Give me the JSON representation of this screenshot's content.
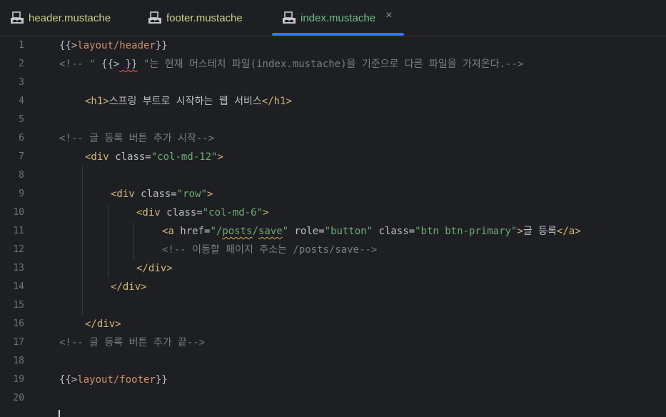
{
  "tabs": [
    {
      "label": "header.mustache",
      "icon": "mustache-file-icon",
      "active": false
    },
    {
      "label": "footer.mustache",
      "icon": "mustache-file-icon",
      "active": false
    },
    {
      "label": "index.mustache",
      "icon": "mustache-file-icon",
      "active": true,
      "close": "×"
    }
  ],
  "line_numbers": [
    "1",
    "2",
    "3",
    "4",
    "5",
    "6",
    "7",
    "8",
    "9",
    "10",
    "11",
    "12",
    "13",
    "14",
    "15",
    "16",
    "17",
    "18",
    "19",
    "20"
  ],
  "code": {
    "l1": {
      "open": "{{>",
      "path": "layout/header",
      "close": "}}"
    },
    "l2": {
      "a": "<!-- \" ",
      "b": "{{>",
      "c": " }}",
      "d": " \"는 현재 머스테치 파일(index.mustache)을 기준으로 다른 파일을 가져온다.-->"
    },
    "l4": {
      "open": "<h1>",
      "text": "스프링 부트로 시작하는 웹 서비스",
      "close": "</h1>"
    },
    "l6": {
      "text": "<!-- 글 등록 버튼 추가 시작-->"
    },
    "l7": {
      "open": "<div ",
      "attr": "class=",
      "val": "\"col-md-12\"",
      "close": ">"
    },
    "l9": {
      "open": "<div ",
      "attr": "class=",
      "val": "\"row\"",
      "close": ">"
    },
    "l10": {
      "open": "<div ",
      "attr": "class=",
      "val": "\"col-md-6\"",
      "close": ">"
    },
    "l11": {
      "open": "<a ",
      "a1": "href=",
      "v1a": "\"/",
      "v1b": "posts",
      "v1c": "/",
      "v1d": "save",
      "v1e": "\"",
      "a2": " role=",
      "v2": "\"button\"",
      "a3": " class=",
      "v3": "\"btn btn-primary\"",
      "gt": ">",
      "text": "글 등록",
      "close": "</a>"
    },
    "l12": {
      "text": "<!-- 이동할 페이지 주소는 /posts/save-->"
    },
    "l13": {
      "text": "</div>"
    },
    "l14": {
      "text": "</div>"
    },
    "l16": {
      "text": "</div>"
    },
    "l17": {
      "text": "<!-- 글 등록 버튼 추가 끝-->"
    },
    "l19": {
      "open": "{{>",
      "path": "layout/footer",
      "close": "}}"
    }
  },
  "colors": {
    "background": "#1e1f22",
    "tag": "#d5b778",
    "string": "#6aab73",
    "comment": "#7a7e85",
    "mustache_path": "#cf8e6d",
    "active_tab_underline": "#3574f0"
  }
}
